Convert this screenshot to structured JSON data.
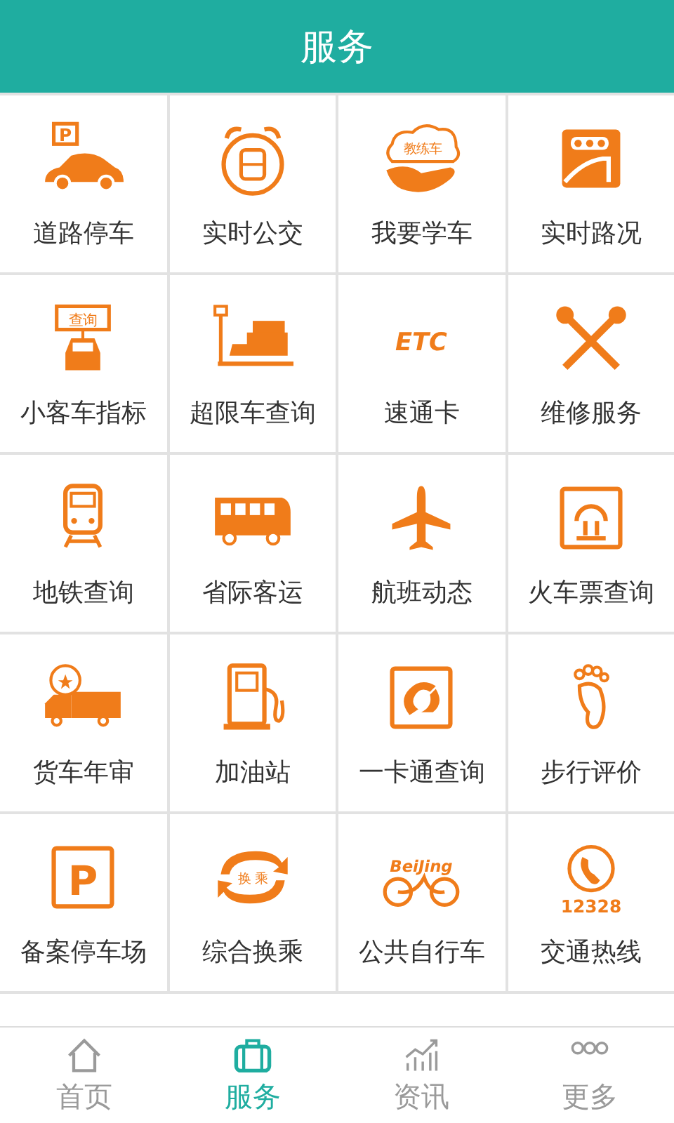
{
  "header": {
    "title": "服务"
  },
  "services": [
    {
      "label": "道路停车",
      "kind": "parking-car",
      "icon_text": "P"
    },
    {
      "label": "实时公交",
      "kind": "alarm-bus"
    },
    {
      "label": "我要学车",
      "kind": "hand-cloud",
      "icon_text": "教练车"
    },
    {
      "label": "实时路况",
      "kind": "traffic-board"
    },
    {
      "label": "小客车指标",
      "kind": "sign-car",
      "icon_text": "查询"
    },
    {
      "label": "超限车查询",
      "kind": "truck-scale"
    },
    {
      "label": "速通卡",
      "kind": "logo-text",
      "icon_text": "ETC"
    },
    {
      "label": "维修服务",
      "kind": "tools"
    },
    {
      "label": "地铁查询",
      "kind": "train"
    },
    {
      "label": "省际客运",
      "kind": "coach"
    },
    {
      "label": "航班动态",
      "kind": "plane"
    },
    {
      "label": "火车票查询",
      "kind": "rail-badge"
    },
    {
      "label": "货车年审",
      "kind": "stamp-truck"
    },
    {
      "label": "加油站",
      "kind": "fuel-pump"
    },
    {
      "label": "一卡通查询",
      "kind": "card-badge"
    },
    {
      "label": "步行评价",
      "kind": "footprint"
    },
    {
      "label": "备案停车场",
      "kind": "parking-sign",
      "icon_text": "P"
    },
    {
      "label": "综合换乘",
      "kind": "transfer",
      "icon_text": "换 乘"
    },
    {
      "label": "公共自行车",
      "kind": "bike-script",
      "icon_text": "BeiJing"
    },
    {
      "label": "交通热线",
      "kind": "phone",
      "icon_text": "12328"
    }
  ],
  "tabs": [
    {
      "label": "首页",
      "kind": "house",
      "selected": false
    },
    {
      "label": "服务",
      "kind": "briefcase",
      "selected": true
    },
    {
      "label": "资讯",
      "kind": "chart",
      "selected": false
    },
    {
      "label": "更多",
      "kind": "dots",
      "selected": false
    }
  ]
}
